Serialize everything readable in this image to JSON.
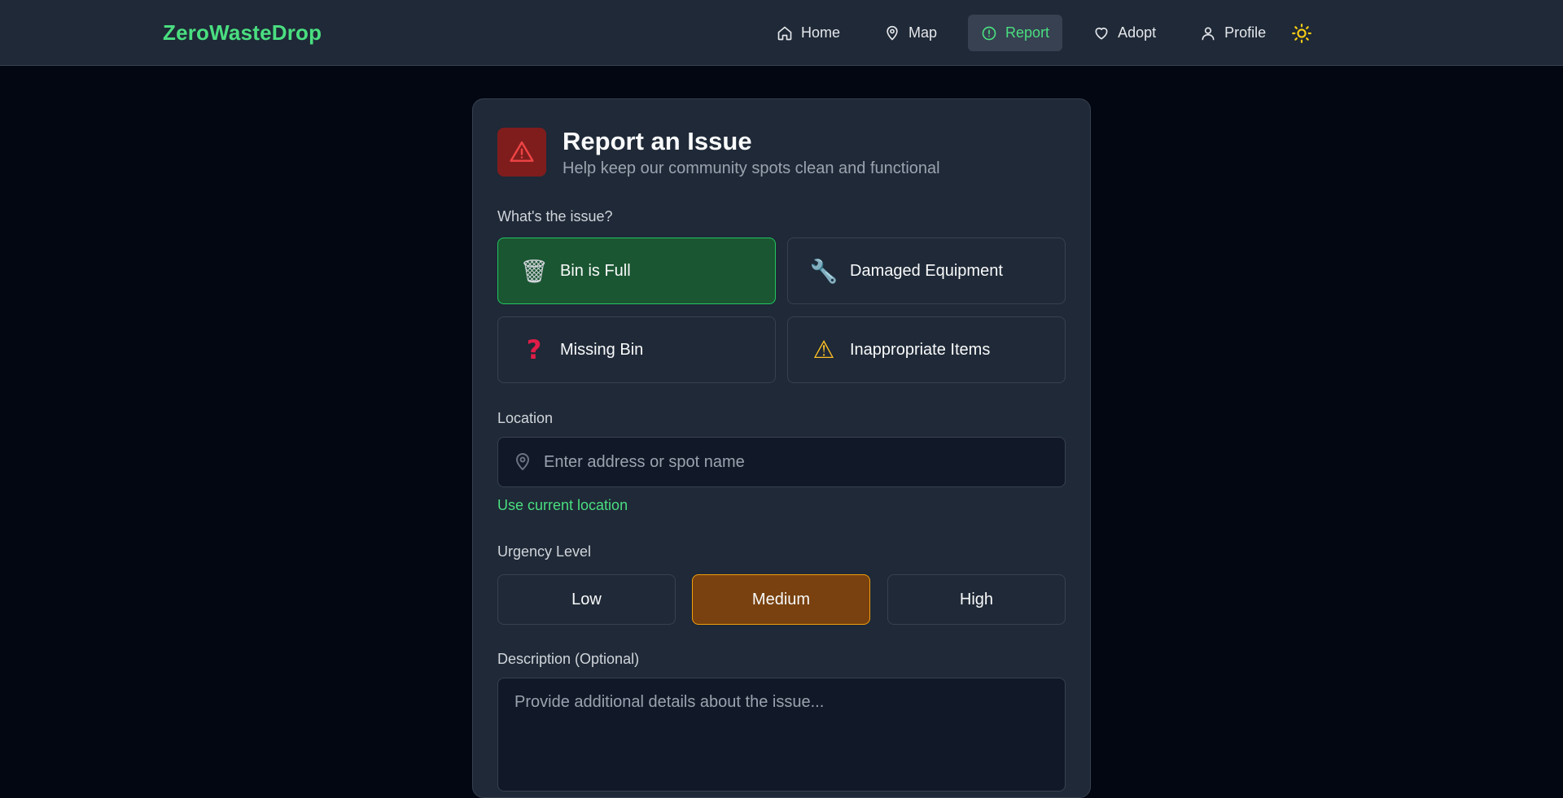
{
  "app": {
    "brand": "ZeroWasteDrop"
  },
  "nav": {
    "items": [
      {
        "label": "Home",
        "icon": "home-icon"
      },
      {
        "label": "Map",
        "icon": "map-pin-icon"
      },
      {
        "label": "Report",
        "icon": "alert-circle-icon",
        "active": true
      },
      {
        "label": "Adopt",
        "icon": "heart-icon"
      },
      {
        "label": "Profile",
        "icon": "user-icon"
      }
    ],
    "theme_toggle_icon": "sun-icon"
  },
  "form": {
    "icon": "warning-triangle-icon",
    "title": "Report an Issue",
    "subtitle": "Help keep our community spots clean and functional",
    "issue_label": "What's the issue?",
    "issues": [
      {
        "label": "Bin is Full",
        "icon": "wastebasket-icon",
        "selected": true
      },
      {
        "label": "Damaged Equipment",
        "icon": "wrench-icon",
        "selected": false
      },
      {
        "label": "Missing Bin",
        "icon": "question-mark-icon",
        "selected": false
      },
      {
        "label": "Inappropriate Items",
        "icon": "warning-icon",
        "selected": false
      }
    ],
    "location_label": "Location",
    "location_placeholder": "Enter address or spot name",
    "location_value": "",
    "use_current_location": "Use current location",
    "urgency_label": "Urgency Level",
    "urgency_options": [
      {
        "label": "Low",
        "selected": false
      },
      {
        "label": "Medium",
        "selected": true
      },
      {
        "label": "High",
        "selected": false
      }
    ],
    "description_label": "Description (Optional)",
    "description_placeholder": "Provide additional details about the issue..."
  },
  "colors": {
    "background": "#030712",
    "surface": "#1f2937",
    "accent_green": "#4ade80",
    "selected_issue_bg": "#1b5632",
    "selected_urgency_bg": "#78410f",
    "danger": "#7f1d1d",
    "sun": "#facc15"
  }
}
